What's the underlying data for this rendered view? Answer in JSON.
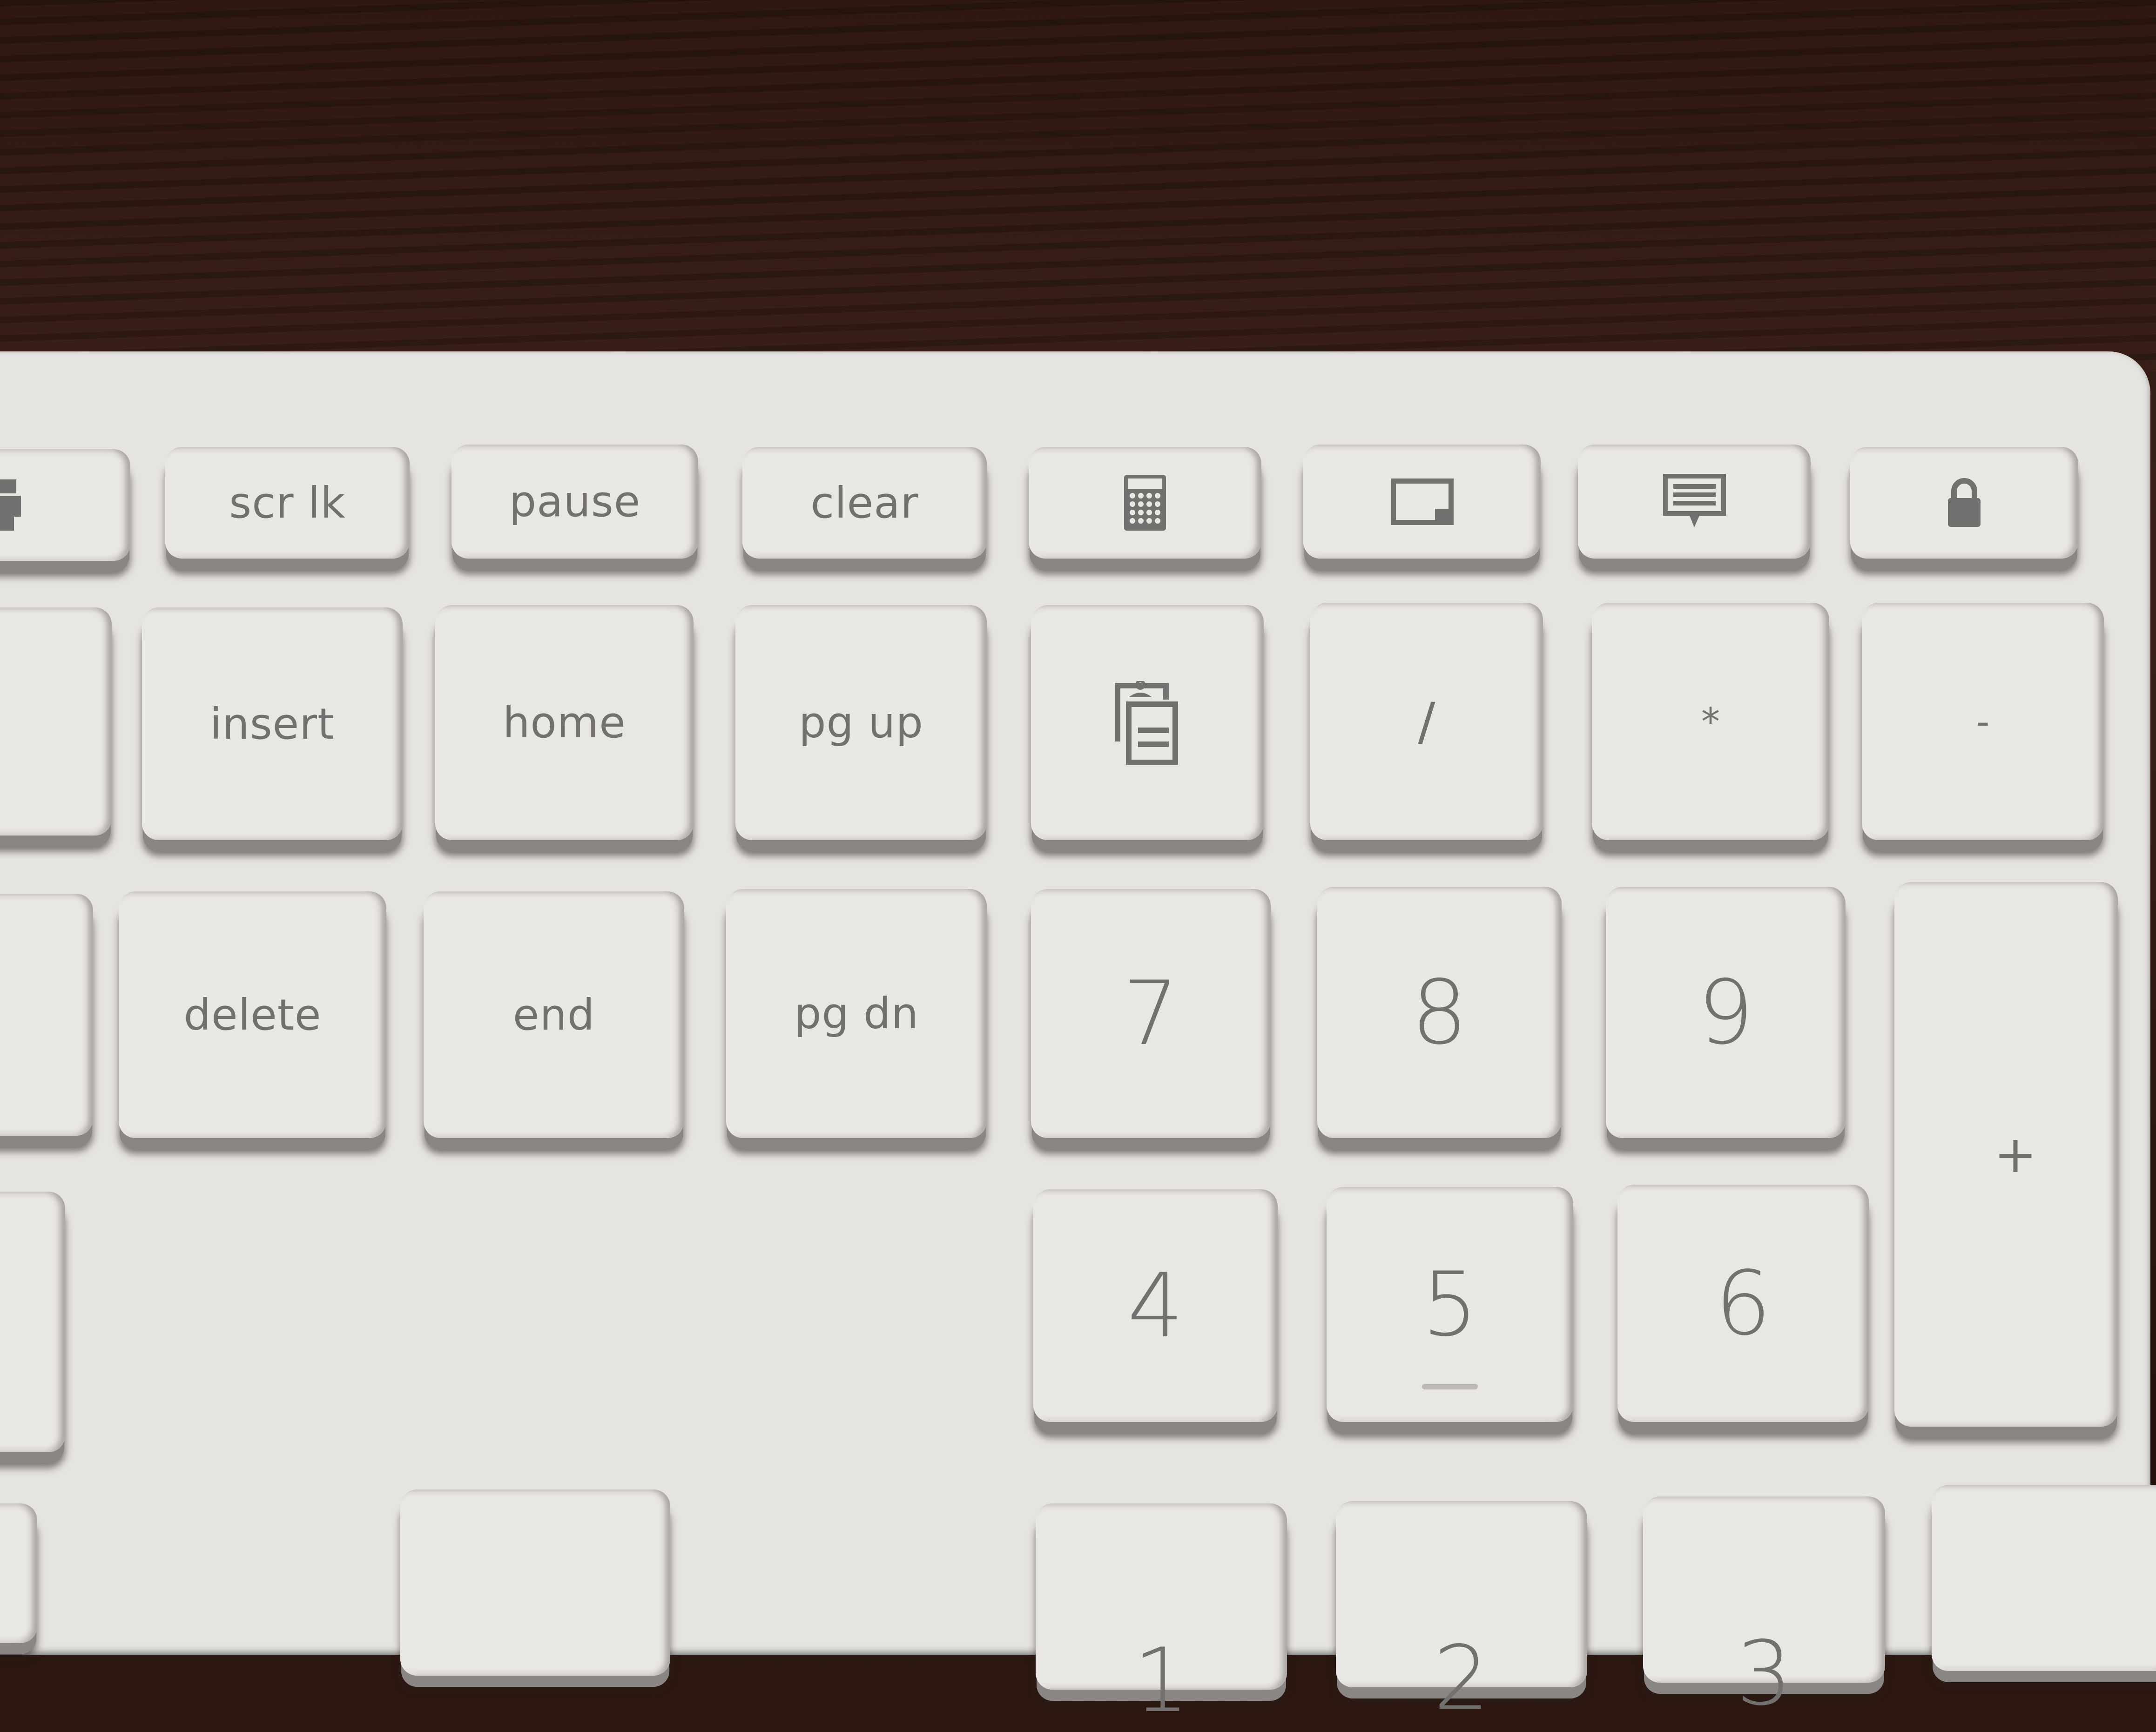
{
  "scene": "close-up photo of a white keyboard navigation cluster and numeric keypad on a dark wood desk",
  "colors": {
    "desk": "#2f1a12",
    "key_face": "#e9e7e4",
    "legend": "#737070",
    "keyboard_body": "#e6e4e1"
  },
  "function_row": [
    {
      "id": "print",
      "icon": "printer-icon"
    },
    {
      "id": "scroll-lock",
      "label": "scr lk"
    },
    {
      "id": "pause",
      "label": "pause"
    },
    {
      "id": "clear",
      "label": "clear"
    },
    {
      "id": "calculator",
      "icon": "calculator-icon"
    },
    {
      "id": "snip",
      "icon": "window-snip-icon"
    },
    {
      "id": "message",
      "icon": "message-icon"
    },
    {
      "id": "lock",
      "icon": "lock-icon"
    }
  ],
  "nav_row_1": [
    {
      "id": "insert",
      "label": "insert"
    },
    {
      "id": "home",
      "label": "home"
    },
    {
      "id": "page-up",
      "label": "pg up"
    }
  ],
  "nav_row_2": [
    {
      "id": "delete",
      "label": "delete"
    },
    {
      "id": "end",
      "label": "end"
    },
    {
      "id": "page-down",
      "label": "pg dn"
    }
  ],
  "numpad_row_1": [
    {
      "id": "clipboard",
      "icon": "clipboard-icon"
    },
    {
      "id": "divide",
      "label": "/"
    },
    {
      "id": "multiply",
      "label": "*"
    },
    {
      "id": "subtract",
      "label": "-"
    }
  ],
  "numpad_row_2": [
    {
      "id": "num7",
      "label": "7"
    },
    {
      "id": "num8",
      "label": "8"
    },
    {
      "id": "num9",
      "label": "9"
    },
    {
      "id": "add",
      "label": "+"
    }
  ],
  "numpad_row_3": [
    {
      "id": "num4",
      "label": "4"
    },
    {
      "id": "num5",
      "label": "5"
    },
    {
      "id": "num6",
      "label": "6"
    }
  ],
  "numpad_row_4_partial": [
    {
      "id": "num1",
      "label": "1"
    },
    {
      "id": "num2",
      "label": "2"
    },
    {
      "id": "num3",
      "label": "3"
    }
  ],
  "partial_left_keys": [
    {
      "id": "backspace-edge",
      "label": "—"
    }
  ]
}
